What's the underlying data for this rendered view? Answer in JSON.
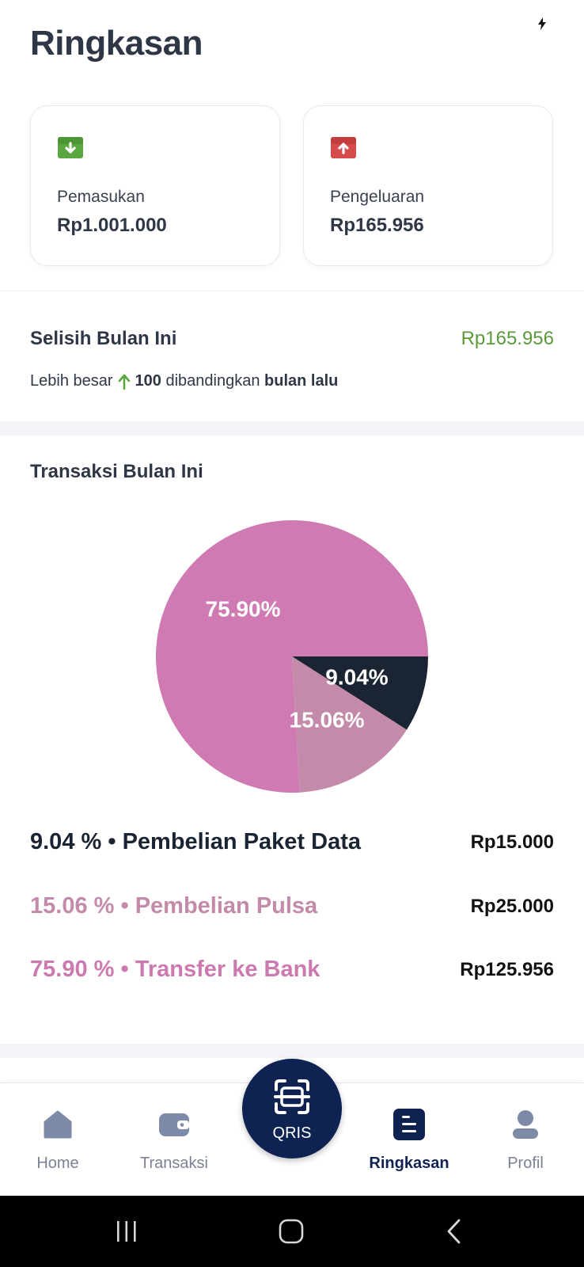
{
  "page": {
    "title": "Ringkasan"
  },
  "summary": {
    "income": {
      "label": "Pemasukan",
      "value": "Rp1.001.000",
      "icon": "income-box-icon",
      "color": "#5aa640"
    },
    "expense": {
      "label": "Pengeluaran",
      "value": "Rp165.956",
      "icon": "expense-box-icon",
      "color": "#d64b4b"
    }
  },
  "difference": {
    "title": "Selisih Bulan Ini",
    "value": "Rp165.956",
    "value_color": "#5b9a3a",
    "prefix": "Lebih besar",
    "amount": "100",
    "middle": "dibandingkan",
    "suffix": "bulan lalu"
  },
  "transactions": {
    "title": "Transaksi Bulan Ini",
    "items": [
      {
        "percent_label": "9.04 %",
        "name": "Pembelian Paket Data",
        "amount": "Rp15.000",
        "color": "#1b2433"
      },
      {
        "percent_label": "15.06 %",
        "name": "Pembelian Pulsa",
        "amount": "Rp25.000",
        "color": "#c48aaa"
      },
      {
        "percent_label": "75.90 %",
        "name": "Transfer ke Bank",
        "amount": "Rp125.956",
        "color": "#cc79b0"
      }
    ]
  },
  "chart_data": {
    "type": "pie",
    "categories": [
      "Pembelian Paket Data",
      "Pembelian Pulsa",
      "Transfer ke Bank"
    ],
    "values": [
      9.04,
      15.06,
      75.9
    ],
    "labels": [
      "9.04%",
      "15.06%",
      "75.90%"
    ],
    "colors": [
      "#1b2433",
      "#c48aaa",
      "#cf7ab2"
    ]
  },
  "nav": {
    "home": {
      "label": "Home",
      "icon": "home-icon"
    },
    "transaksi": {
      "label": "Transaksi",
      "icon": "wallet-icon"
    },
    "qris": {
      "label": "QRIS",
      "icon": "qr-scan-icon"
    },
    "ringkasan": {
      "label": "Ringkasan",
      "icon": "summary-icon",
      "active": true
    },
    "profil": {
      "label": "Profil",
      "icon": "user-icon"
    }
  },
  "system_nav": {
    "recent": "recent-apps-icon",
    "home": "home-circle-icon",
    "back": "back-icon"
  }
}
